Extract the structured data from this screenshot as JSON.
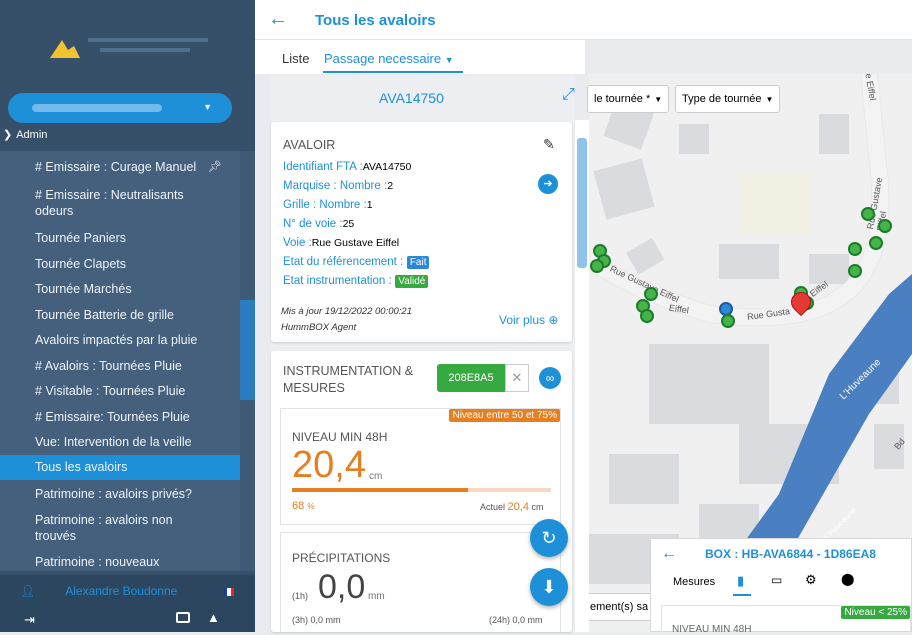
{
  "sidebar": {
    "section": "Admin",
    "items": [
      {
        "label": "# Emissaire : Curage Manuel",
        "pin": "★"
      },
      {
        "label": "# Emissaire : Neutralisants odeurs"
      },
      {
        "label": "Tournée Paniers"
      },
      {
        "label": "Tournée Clapets"
      },
      {
        "label": "Tournée Marchés"
      },
      {
        "label": "Tournée Batterie de grille"
      },
      {
        "label": "Avaloirs impactés par la pluie"
      },
      {
        "label": "# Avaloirs : Tournées Pluie"
      },
      {
        "label": "# Visitable : Tournées Pluie"
      },
      {
        "label": "# Emissaire: Tournées Pluie"
      },
      {
        "label": "Vue: Intervention de la veille"
      },
      {
        "label": "Tous les avaloirs"
      },
      {
        "label": "Patrimoine : avaloirs privés?"
      },
      {
        "label": "Patrimoine : avaloirs non trouvés"
      },
      {
        "label": "Patrimoine : nouveaux"
      }
    ],
    "user": "Alexandre Boudonne",
    "icons": [
      "logout-icon",
      "book-icon",
      "rocket-icon"
    ]
  },
  "header": {
    "title": "Tous les avaloirs",
    "tab_list": "Liste",
    "tab_passage": "Passage necessaire"
  },
  "detail": {
    "id": "AVA14750",
    "avaloir": {
      "section": "AVALOIR",
      "fields": [
        {
          "label": "Identifiant FTA :",
          "value": "AVA14750"
        },
        {
          "label": "Marquise : Nombre :",
          "value": "2"
        },
        {
          "label": "Grille : Nombre :",
          "value": "1"
        },
        {
          "label": "N° de voie :",
          "value": "25"
        },
        {
          "label": "Voie :",
          "value": "Rue Gustave Eiffel"
        }
      ],
      "ref_label": "Etat du référencement :",
      "ref_badge": "Fait",
      "instr_label": "Etat instrumentation :",
      "instr_badge": "Validé",
      "updated": "Mis à jour 19/12/2022 00:00:21",
      "agent": "HummBOX Agent",
      "more": "Voir plus"
    },
    "instrumentation": {
      "title1": "INSTRUMENTATION &",
      "title2": "MESURES",
      "box": "208E8A5",
      "niveau": {
        "badge": "Niveau entre 50 et 75%",
        "label": "NIVEAU MIN 48H",
        "value": "20,4",
        "unit": "cm",
        "percent": 68,
        "percent_label": "68",
        "pct_unit": "%",
        "actual_label": "Actuel",
        "actual_value": "20,4",
        "actual_unit": "cm"
      },
      "precip": {
        "label": "PRÉCIPITATIONS",
        "h1": "(1h)",
        "value": "0,0",
        "unit": "mm",
        "h3": "(3h) 0,0 mm",
        "h24": "(24h) 0,0 mm"
      }
    }
  },
  "map": {
    "filter1": "le tournée *",
    "filter2": "Type de tournée",
    "streets": [
      "Rue Gustave Eiffel",
      "Eiffel",
      "Rue Gusta",
      "Rue Gustave Eiffel",
      "e Eiffel",
      "L'Huveaune",
      "Bd",
      "L'Huveaune"
    ],
    "footer_text": "ement(s) sa",
    "box_panel": {
      "title": "BOX : HB-AVA6844 - 1D86EA8",
      "tab": "Mesures",
      "badge": "Niveau < 25%",
      "niveau": "NIVEAU MIN 48H"
    },
    "colors": {
      "green": "#45b549",
      "blue": "#2b88d8",
      "red": "#e53935",
      "water": "#4a7fc1"
    }
  }
}
